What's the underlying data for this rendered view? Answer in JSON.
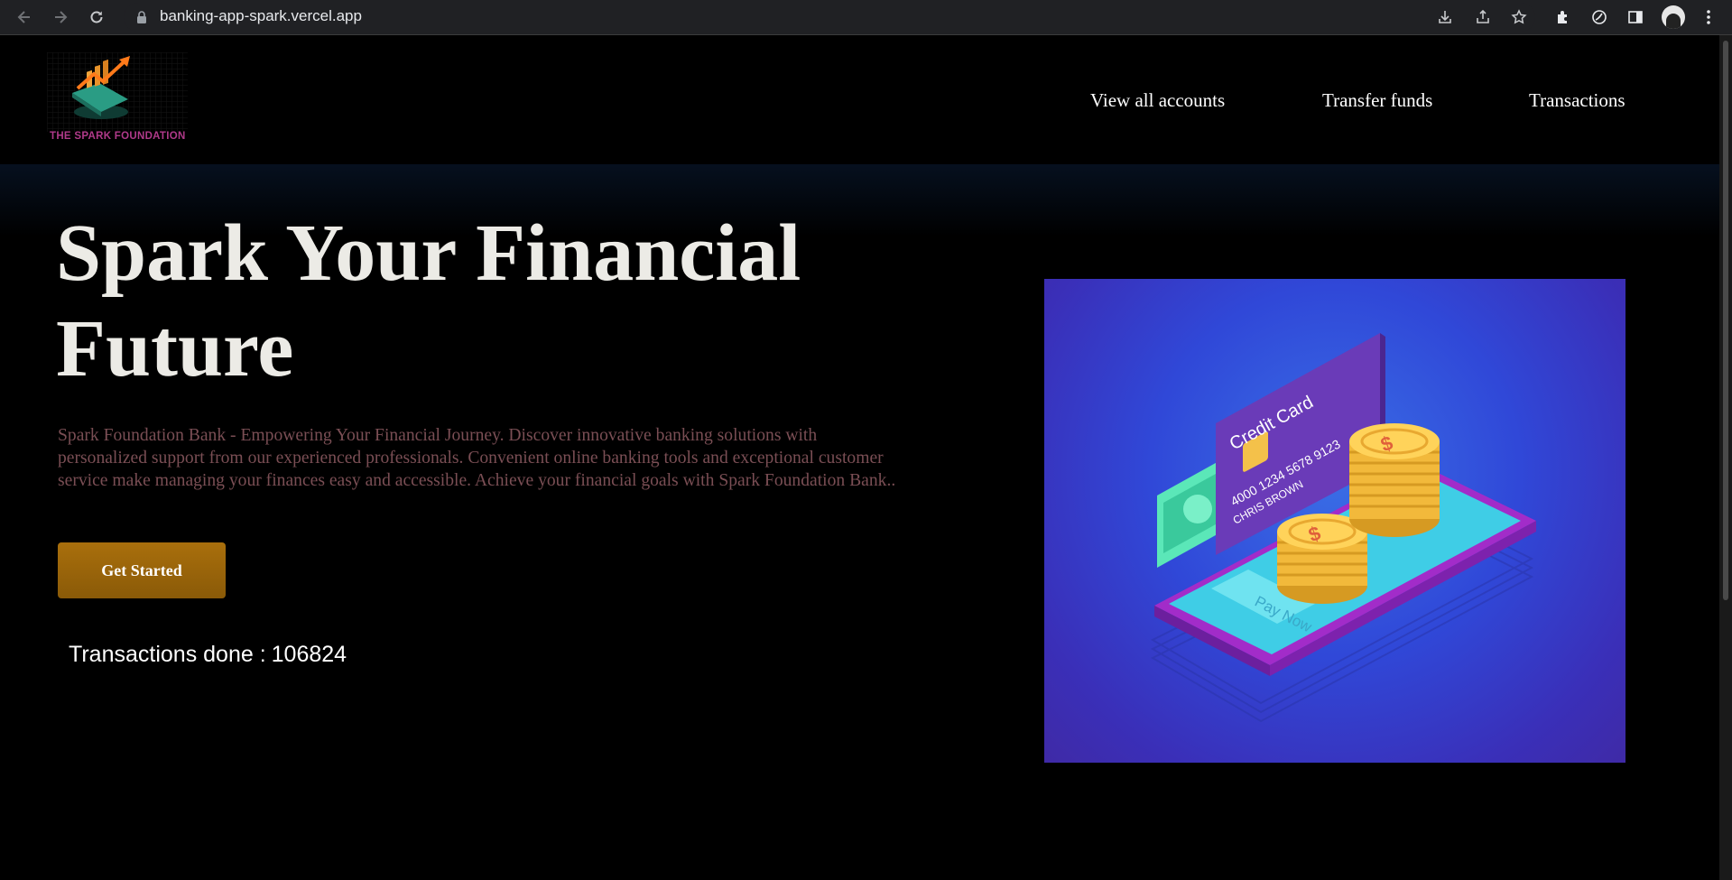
{
  "browser": {
    "url": "banking-app-spark.vercel.app"
  },
  "header": {
    "logo_text": "THE SPARK FOUNDATION",
    "nav": [
      "View all accounts",
      "Transfer funds",
      "Transactions"
    ]
  },
  "hero": {
    "title_line1": "Spark Your Financial",
    "title_line2": "Future",
    "description": "Spark Foundation Bank - Empowering Your Financial Journey. Discover innovative banking solutions with personalized support from our experienced professionals. Convenient online banking tools and exceptional customer service make managing your finances easy and accessible. Achieve your financial goals with Spark Foundation Bank..",
    "cta_label": "Get Started",
    "transactions_label": "Transactions done :",
    "transactions_count": "106824"
  },
  "illustration": {
    "card_label": "Credit Card",
    "card_number": "4000 1234 5678 9123",
    "card_holder": "CHRIS BROWN",
    "pay_label": "Pay Now",
    "coin_symbol": "$"
  },
  "icons": [
    "back-icon",
    "forward-icon",
    "reload-icon",
    "lock-icon",
    "download-icon",
    "share-icon",
    "star-icon",
    "extensions-icon",
    "sync-icon",
    "sidebar-icon",
    "avatar",
    "more-icon"
  ]
}
